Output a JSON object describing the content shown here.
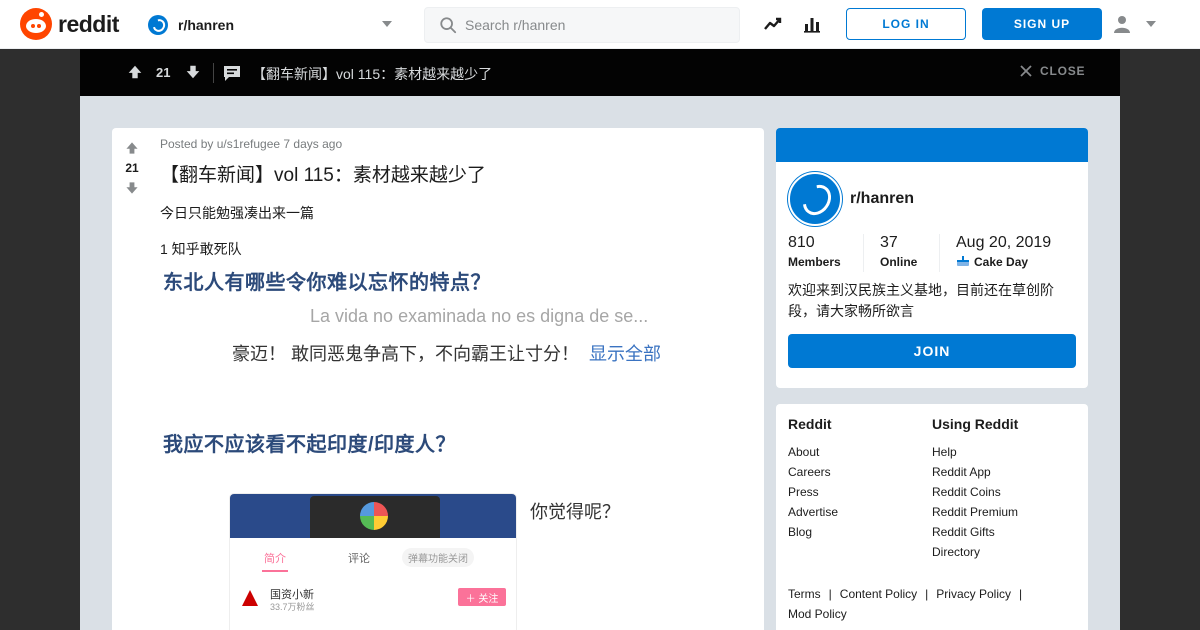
{
  "topnav": {
    "logo_text": "reddit",
    "subreddit": "r/hanren",
    "search_placeholder": "Search r/hanren",
    "login_label": "LOG IN",
    "signup_label": "SIGN UP",
    "icons": [
      "trending-icon",
      "stats-icon",
      "user-icon"
    ]
  },
  "postbar": {
    "score": "21",
    "title": "【翻车新闻】vol 115：素材越来越少了",
    "close_label": "CLOSE"
  },
  "post": {
    "score": "21",
    "meta": "Posted by u/s1refugee 7 days ago",
    "title": "【翻车新闻】vol 115：素材越来越少了",
    "body_line1": "今日只能勉强凑出来一篇",
    "body_line2": "1 知乎敢死队",
    "image": {
      "question1": "东北人有哪些令你难以忘怀的特点？",
      "answer_faded": "La vida no examinada no es digna de se...",
      "answer_text": "豪迈！ 敢同恶鬼争高下，不向霸王让寸分！",
      "answer_more": "显示全部",
      "question2": "我应不应该看不起印度/印度人？",
      "phone_tab1": "简介",
      "phone_tab2": "评论",
      "phone_tab3": "弹幕功能关闭",
      "phone_account": "国资小新",
      "phone_fans": "33.7万粉丝",
      "phone_follow": "＋ 关注",
      "caption": "你觉得呢？"
    }
  },
  "sidebar": {
    "community_name": "r/hanren",
    "members_value": "810",
    "members_label": "Members",
    "online_value": "37",
    "online_label": "Online",
    "cakeday_value": "Aug 20, 2019",
    "cakeday_label": "Cake Day",
    "description": "欢迎来到汉民族主义基地，目前还在草创阶段，请大家畅所欲言",
    "join_label": "JOIN"
  },
  "footer": {
    "col1_title": "Reddit",
    "col1_links": [
      "About",
      "Careers",
      "Press",
      "Advertise",
      "Blog"
    ],
    "col2_title": "Using Reddit",
    "col2_links": [
      "Help",
      "Reddit App",
      "Reddit Coins",
      "Reddit Premium",
      "Reddit Gifts",
      "Directory"
    ],
    "policies": [
      "Terms",
      "Content Policy",
      "Privacy Policy",
      "Mod Policy"
    ]
  },
  "colors": {
    "brand_orange": "#ff4500",
    "primary_blue": "#0079d3",
    "page_bg": "#dae0e6",
    "postbar_bg": "#030303"
  }
}
